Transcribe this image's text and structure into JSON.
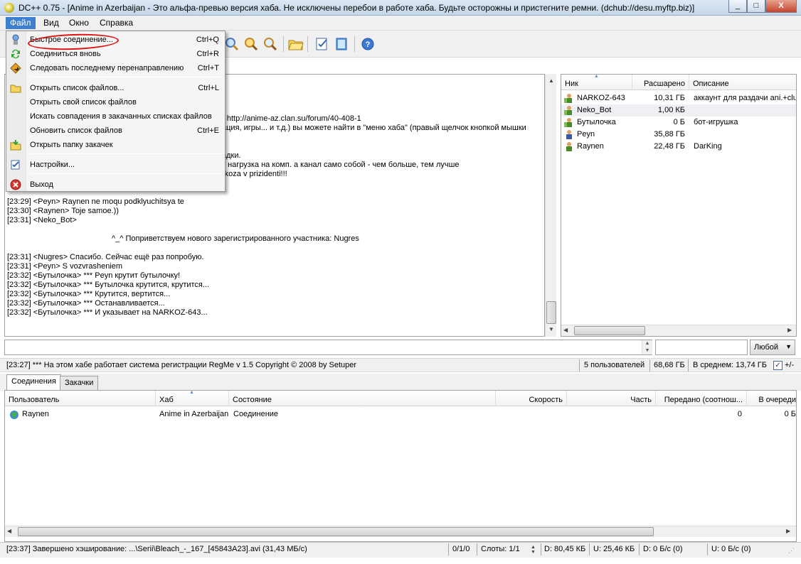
{
  "window": {
    "title": "DC++ 0.75 - [Anime in Azerbaijan - Это альфа-превью версия хаба. Не исключены перебои в работе хаба. Будьте осторожны и пристегните ремни. (dchub://desu.myftp.biz)]",
    "minimize": "_",
    "maximize": "□",
    "close": "X"
  },
  "menu": {
    "items": [
      "Файл",
      "Вид",
      "Окно",
      "Справка"
    ]
  },
  "file_menu": {
    "items": [
      {
        "icon": "network-icon",
        "label": "Быстрое соединение...",
        "shortcut": "Ctrl+Q"
      },
      {
        "icon": "reconnect-icon",
        "label": "Соединиться вновь",
        "shortcut": "Ctrl+R"
      },
      {
        "icon": "redirect-icon",
        "label": "Следовать последнему перенаправлению",
        "shortcut": "Ctrl+T"
      },
      {
        "icon": "folder-open-icon",
        "label": "Открыть список файлов...",
        "shortcut": "Ctrl+L"
      },
      {
        "icon": "",
        "label": "Открыть свой список файлов",
        "shortcut": ""
      },
      {
        "icon": "",
        "label": "Искать совпадения в закачанных списках файлов",
        "shortcut": ""
      },
      {
        "icon": "",
        "label": "Обновить список файлов",
        "shortcut": "Ctrl+E"
      },
      {
        "icon": "folder-download-icon",
        "label": "Открыть папку закачек",
        "shortcut": ""
      },
      {
        "icon": "settings-icon",
        "label": "Настройки...",
        "shortcut": ""
      },
      {
        "icon": "exit-icon",
        "label": "Выход",
        "shortcut": ""
      }
    ]
  },
  "chat": {
    "lines": [
      "ь: http://anime-az.clan.su/forum/40-408-1",
      "ация, игры... и т.д.) вы можете найти в \"меню хаба\" (правый щелчок кнопкой мышки",
      "адки.",
      "т нагрузка на комп. а канал само собой - чем больше, тем лучше",
      "rkoza v prizidenti!!!",
      "[23:29] <Peyn> Raynen ne moqu podklyuchitsya te",
      "[23:30] <Raynen> Toje samoe.))",
      "[23:31] <Neko_Bot>",
      "^_^ Поприветствуем нового зарегистрированного участника: Nugres",
      "[23:31] <Nugres> Спасибо. Сейчас ещё раз попробую.",
      "[23:31] <Peyn> S vozvrasheniem",
      "[23:32] <Бутылочка> *** Peyn крутит бутылочку!",
      "[23:32] <Бутылочка> *** Бутылочка крутится, крутится...",
      "[23:32] <Бутылочка> *** Крутится, вертится...",
      "[23:32] <Бутылочка> *** Останавливается...",
      "[23:32] <Бутылочка> *** И указывает на NARKOZ-643..."
    ]
  },
  "users": {
    "columns": [
      "Ник",
      "Расшарено",
      "Описание"
    ],
    "rows": [
      {
        "nick": "NARKOZ-643",
        "shared": "10,31 ГБ",
        "desc": "аккаунт для раздачи ani.+clu"
      },
      {
        "nick": "Neko_Bot",
        "shared": "1,00 КБ",
        "desc": ""
      },
      {
        "nick": "Бутылочка",
        "shared": "0 Б",
        "desc": "бот-игрушка"
      },
      {
        "nick": "Peyn",
        "shared": "35,88 ГБ",
        "desc": ""
      },
      {
        "nick": "Raynen",
        "shared": "22,48 ГБ",
        "desc": "DarKing"
      }
    ]
  },
  "filter": {
    "combo": "Любой"
  },
  "status": {
    "message": "[23:27] *** На этом хабе работает система регистрации RegMe v 1.5 Copyright © 2008 by Setuper",
    "users": "5 пользователей",
    "share": "68,68 ГБ",
    "average": "В среднем: 13,74 ГБ",
    "toggle": "+/-"
  },
  "tabs": [
    "Соединения",
    "Закачки"
  ],
  "transfers": {
    "columns": [
      "Пользователь",
      "Хаб",
      "Состояние",
      "Скорость",
      "Часть",
      "Передано (соотнош...",
      "В очереди"
    ],
    "rows": [
      {
        "user": "Raynen",
        "hub": "Anime in Azerbaijan",
        "state": "Соединение",
        "speed": "",
        "part": "",
        "transferred": "0",
        "queued": "0 Б"
      }
    ]
  },
  "bottom": {
    "message": "[23:37] Завершено хэширование: ...\\Serii\\Bleach_-_167_[45843A23].avi (31,43 МБ/с)",
    "hubs": "0/1/0",
    "slots": "Слоты: 1/1",
    "down": "D: 80,45 КБ",
    "up": "U: 25,46 КБ",
    "down_speed": "D: 0 Б/с (0)",
    "up_speed": "U: 0 Б/с (0)"
  }
}
